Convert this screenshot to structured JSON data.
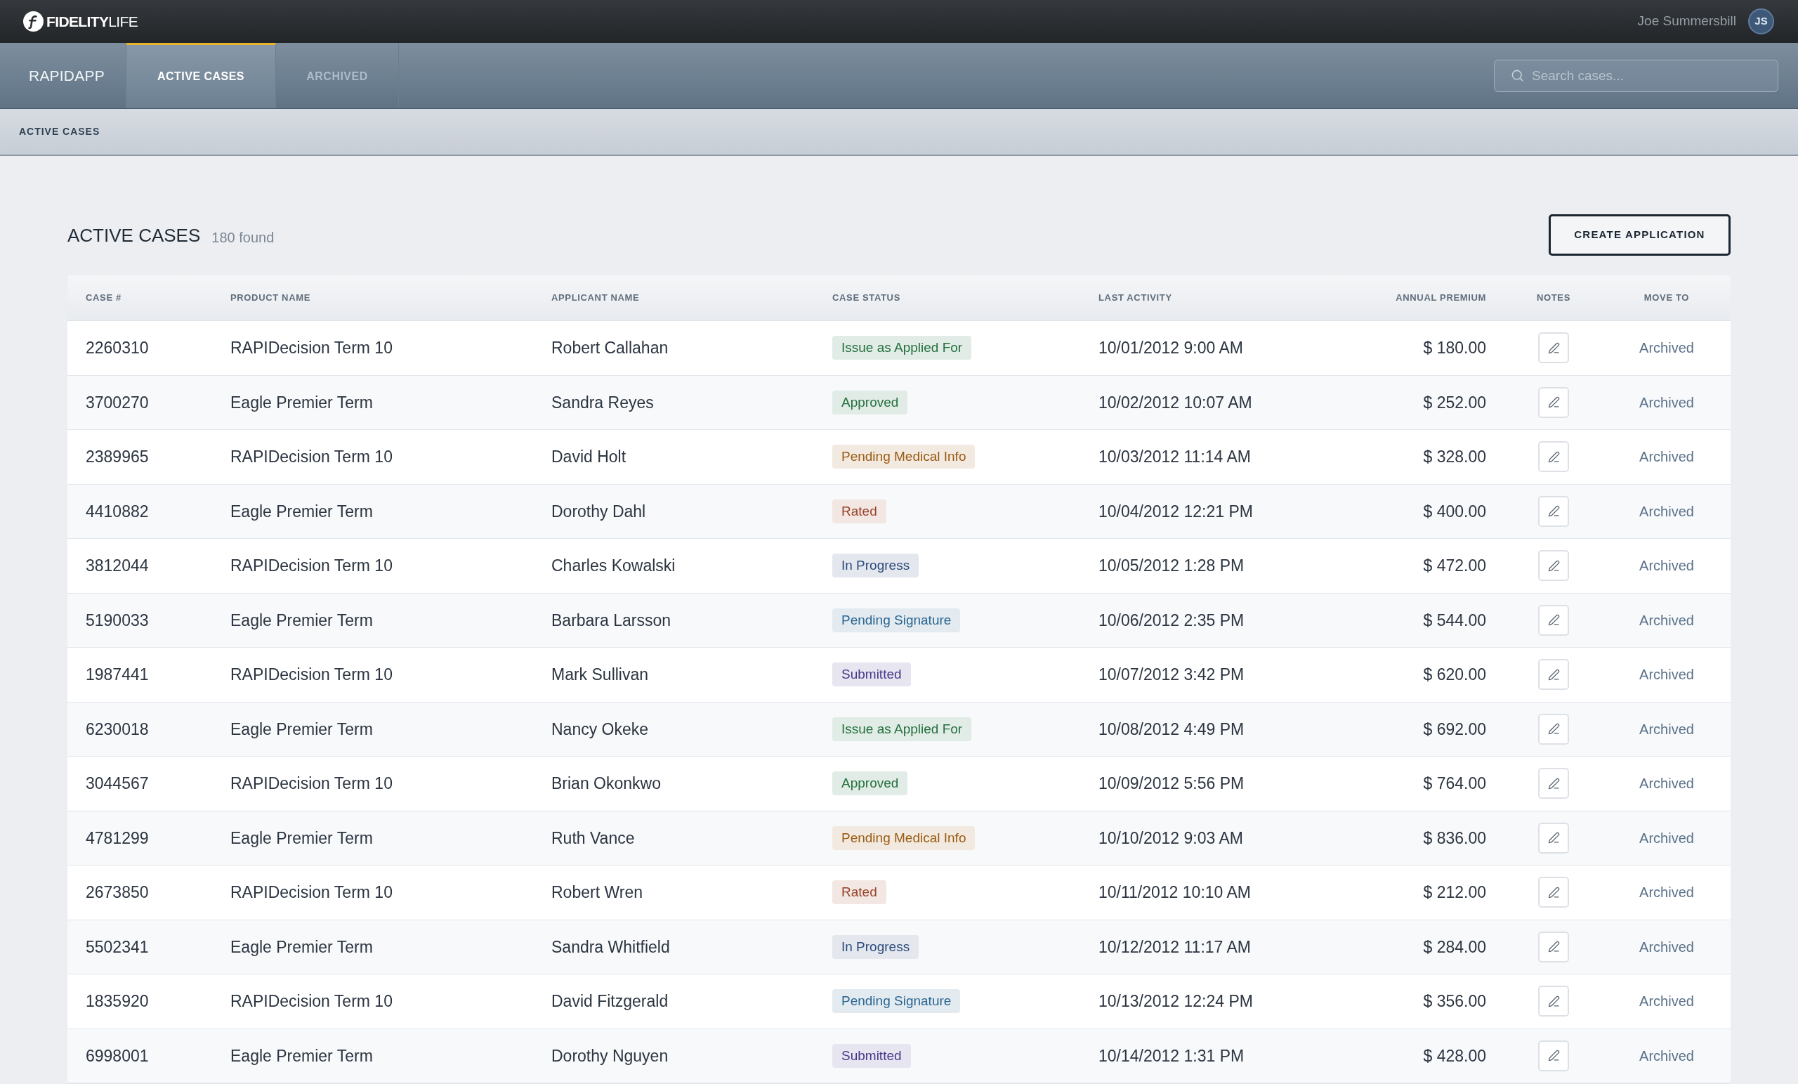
{
  "top_bar": {
    "logo": "**FIDELITY**LIFE",
    "user_name": "Joe Summersbill",
    "avatar_initials": "JS"
  },
  "nav": {
    "app_name": "RAPIDAPP",
    "tabs": [
      {
        "label": "ACTIVE CASES",
        "selected": true
      },
      {
        "label": "ARCHIVED",
        "selected": false
      }
    ],
    "search": {
      "placeholder": "Search cases..."
    }
  },
  "breadcrumb": "ACTIVE CASES",
  "page": {
    "title": "ACTIVE CASES",
    "count": "180 found",
    "create_button": "CREATE APPLICATION"
  },
  "table": {
    "columns": [
      "CASE #",
      "PRODUCT NAME",
      "APPLICANT NAME",
      "CASE STATUS",
      "LAST ACTIVITY",
      "ANNUAL PREMIUM",
      "NOTES",
      "MOVE TO"
    ],
    "rows": [
      {
        "case": "2260310",
        "product": "RAPIDecision Term 10",
        "applicant": "Robert Callahan",
        "status": {
          "label": "Issue as Applied For",
          "color": "#22703e"
        },
        "last_activity": "10/01/2012 9:00 AM",
        "premium": "$ 180.00",
        "move_to": "Archived"
      },
      {
        "case": "3700270",
        "product": "Eagle Premier Term",
        "applicant": "Sandra Reyes",
        "status": {
          "label": "Approved",
          "color": "#22703e"
        },
        "last_activity": "10/02/2012 10:07 AM",
        "premium": "$ 252.00",
        "move_to": "Archived"
      },
      {
        "case": "2389965",
        "product": "RAPIDecision Term 10",
        "applicant": "David Holt",
        "status": {
          "label": "Pending Medical Info",
          "color": "#9a5b12"
        },
        "last_activity": "10/03/2012 11:14 AM",
        "premium": "$ 328.00",
        "move_to": "Archived"
      },
      {
        "case": "4410882",
        "product": "Eagle Premier Term",
        "applicant": "Dorothy Dahl",
        "status": {
          "label": "Rated",
          "color": "#98432a"
        },
        "last_activity": "10/04/2012 12:21 PM",
        "premium": "$ 400.00",
        "move_to": "Archived"
      },
      {
        "case": "3812044",
        "product": "RAPIDecision Term 10",
        "applicant": "Charles Kowalski",
        "status": {
          "label": "In Progress",
          "color": "#2c4b7a"
        },
        "last_activity": "10/05/2012 1:28 PM",
        "premium": "$ 472.00",
        "move_to": "Archived"
      },
      {
        "case": "5190033",
        "product": "Eagle Premier Term",
        "applicant": "Barbara Larsson",
        "status": {
          "label": "Pending Signature",
          "color": "#2b6590"
        },
        "last_activity": "10/06/2012 2:35 PM",
        "premium": "$ 544.00",
        "move_to": "Archived"
      },
      {
        "case": "1987441",
        "product": "RAPIDecision Term 10",
        "applicant": "Mark Sullivan",
        "status": {
          "label": "Submitted",
          "color": "#47388a"
        },
        "last_activity": "10/07/2012 3:42 PM",
        "premium": "$ 620.00",
        "move_to": "Archived"
      },
      {
        "case": "6230018",
        "product": "Eagle Premier Term",
        "applicant": "Nancy Okeke",
        "status": {
          "label": "Issue as Applied For",
          "color": "#22703e"
        },
        "last_activity": "10/08/2012 4:49 PM",
        "premium": "$ 692.00",
        "move_to": "Archived"
      },
      {
        "case": "3044567",
        "product": "RAPIDecision Term 10",
        "applicant": "Brian Okonkwo",
        "status": {
          "label": "Approved",
          "color": "#22703e"
        },
        "last_activity": "10/09/2012 5:56 PM",
        "premium": "$ 764.00",
        "move_to": "Archived"
      },
      {
        "case": "4781299",
        "product": "Eagle Premier Term",
        "applicant": "Ruth Vance",
        "status": {
          "label": "Pending Medical Info",
          "color": "#9a5b12"
        },
        "last_activity": "10/10/2012 9:03 AM",
        "premium": "$ 836.00",
        "move_to": "Archived"
      },
      {
        "case": "2673850",
        "product": "RAPIDecision Term 10",
        "applicant": "Robert Wren",
        "status": {
          "label": "Rated",
          "color": "#98432a"
        },
        "last_activity": "10/11/2012 10:10 AM",
        "premium": "$ 212.00",
        "move_to": "Archived"
      },
      {
        "case": "5502341",
        "product": "Eagle Premier Term",
        "applicant": "Sandra Whitfield",
        "status": {
          "label": "In Progress",
          "color": "#2c4b7a"
        },
        "last_activity": "10/12/2012 11:17 AM",
        "premium": "$ 284.00",
        "move_to": "Archived"
      },
      {
        "case": "1835920",
        "product": "RAPIDecision Term 10",
        "applicant": "David Fitzgerald",
        "status": {
          "label": "Pending Signature",
          "color": "#2b6590"
        },
        "last_activity": "10/13/2012 12:24 PM",
        "premium": "$ 356.00",
        "move_to": "Archived"
      },
      {
        "case": "6998001",
        "product": "Eagle Premier Term",
        "applicant": "Dorothy Nguyen",
        "status": {
          "label": "Submitted",
          "color": "#47388a"
        },
        "last_activity": "10/14/2012 1:31 PM",
        "premium": "$ 428.00",
        "move_to": "Archived"
      }
    ]
  }
}
